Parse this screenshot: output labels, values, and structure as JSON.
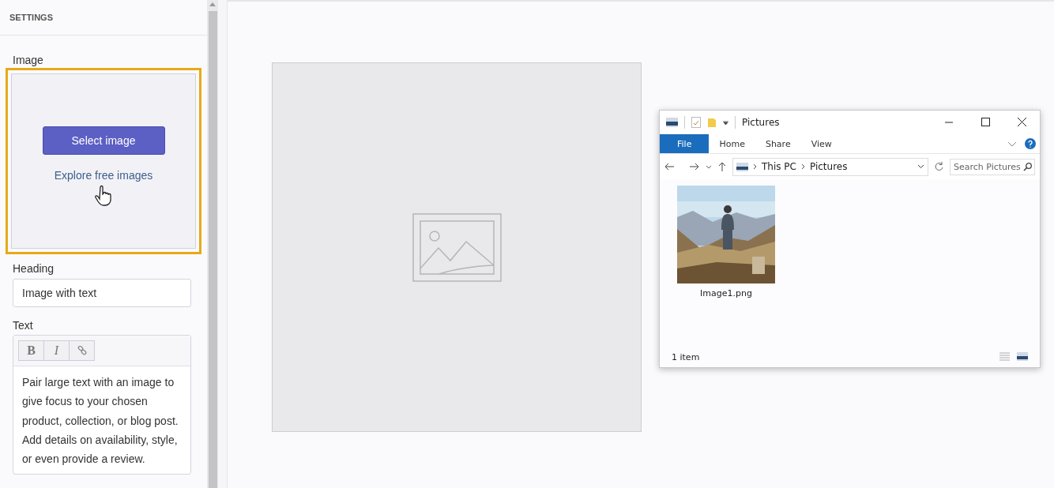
{
  "sidebar": {
    "title": "SETTINGS",
    "image": {
      "label": "Image",
      "highlighted": true,
      "button": "Select image",
      "link": "Explore free images"
    },
    "heading": {
      "label": "Heading",
      "value": "Image with text"
    },
    "text": {
      "label": "Text",
      "format_buttons": [
        "B",
        "I"
      ],
      "body": "Pair large text with an image to give focus to your chosen product, collection, or blog post. Add details on availability, style, or even provide a review."
    }
  },
  "explorer": {
    "title": "Pictures",
    "tabs": [
      {
        "label": "File",
        "selected": true
      },
      {
        "label": "Home",
        "selected": false
      },
      {
        "label": "Share",
        "selected": false
      },
      {
        "label": "View",
        "selected": false
      }
    ],
    "breadcrumb": [
      "This PC",
      "Pictures"
    ],
    "search": {
      "placeholder": "Search Pictures"
    },
    "files": [
      {
        "name": "Image1.png",
        "kind": "picture"
      }
    ],
    "status_bar": "1 item"
  }
}
